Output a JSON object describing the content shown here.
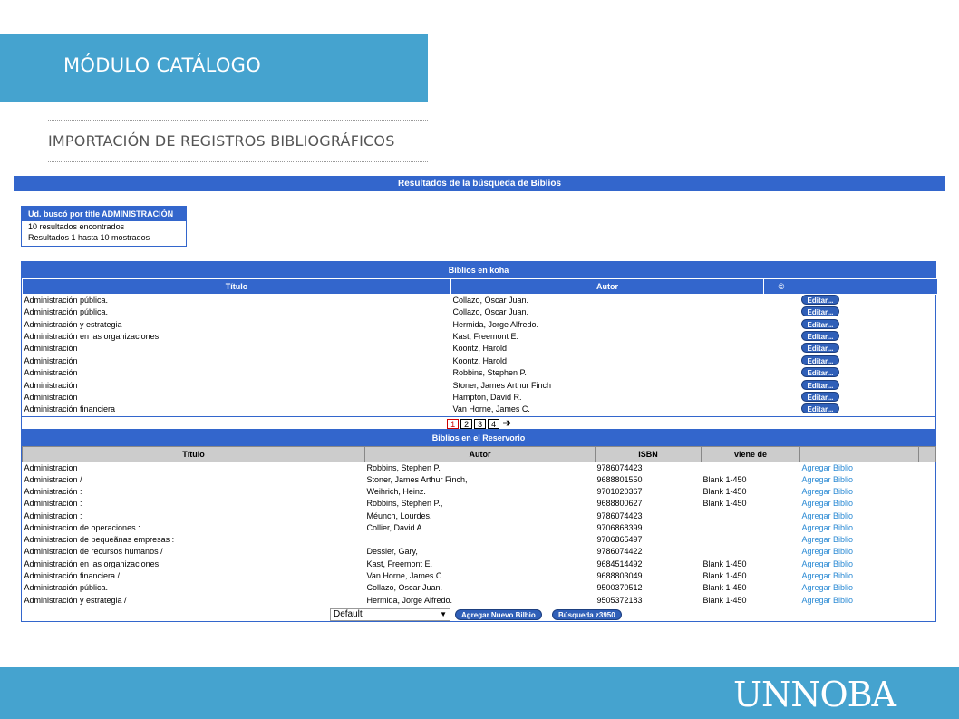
{
  "header": {
    "title": "MÓDULO CATÁLOGO",
    "subtitle": "IMPORTACIÓN DE REGISTROS BIBLIOGRÁFICOS"
  },
  "results_bar": "Resultados de la búsqueda de Biblios",
  "search_box": {
    "heading": "Ud. buscó por title ADMINISTRACIÓN",
    "line1": "10 resultados encontrados",
    "line2": "Resultados 1 hasta 10 mostrados"
  },
  "koha": {
    "title": "Biblios en koha",
    "columns": {
      "title": "Título",
      "author": "Autor",
      "copyright": "©"
    },
    "edit_label": "Editar...",
    "rows": [
      {
        "title": "Administración pública.",
        "author": "Collazo, Oscar Juan."
      },
      {
        "title": "Administración pública.",
        "author": "Collazo, Oscar Juan."
      },
      {
        "title": "Administración y estrategia",
        "author": "Hermida, Jorge Alfredo."
      },
      {
        "title": "Administración en las organizaciones",
        "author": "Kast, Freemont E."
      },
      {
        "title": "Administración",
        "author": "Koontz, Harold"
      },
      {
        "title": "Administración",
        "author": "Koontz, Harold"
      },
      {
        "title": "Administración",
        "author": "Robbins, Stephen P."
      },
      {
        "title": "Administración",
        "author": "Stoner, James Arthur Finch"
      },
      {
        "title": "Administración",
        "author": "Hampton, David R."
      },
      {
        "title": "Administración financiera",
        "author": "Van Horne, James C."
      }
    ],
    "pages": [
      "1",
      "2",
      "3",
      "4"
    ],
    "next_arrow": "➔"
  },
  "reservorio": {
    "title": "Biblios en el Reservorio",
    "columns": {
      "title": "Título",
      "author": "Autor",
      "isbn": "ISBN",
      "viene_de": "viene de"
    },
    "action_label": "Agregar Biblio",
    "rows": [
      {
        "title": "Administracion",
        "author": "Robbins, Stephen P.",
        "isbn": "9786074423",
        "source": ""
      },
      {
        "title": "Administracion /",
        "author": "Stoner, James Arthur Finch,",
        "isbn": "9688801550",
        "source": "Blank 1-450"
      },
      {
        "title": "Administración :",
        "author": "Weihrich, Heinz.",
        "isbn": "9701020367",
        "source": "Blank 1-450"
      },
      {
        "title": "Administración :",
        "author": "Robbins, Stephen P.,",
        "isbn": "9688800627",
        "source": "Blank 1-450"
      },
      {
        "title": "Administracion :",
        "author": "Méunch, Lourdes.",
        "isbn": "9786074423",
        "source": ""
      },
      {
        "title": "Administracion de operaciones :",
        "author": "Collier, David A.",
        "isbn": "9706868399",
        "source": ""
      },
      {
        "title": "Administracion de pequeãnas empresas :",
        "author": "",
        "isbn": "9706865497",
        "source": ""
      },
      {
        "title": "Administracion de recursos humanos /",
        "author": "Dessler, Gary,",
        "isbn": "9786074422",
        "source": ""
      },
      {
        "title": "Administración en las organizaciones",
        "author": "Kast, Freemont E.",
        "isbn": "9684514492",
        "source": "Blank 1-450"
      },
      {
        "title": "Administración financiera /",
        "author": "Van Horne, James C.",
        "isbn": "9688803049",
        "source": "Blank 1-450"
      },
      {
        "title": "Administración pública.",
        "author": "Collazo, Oscar Juan.",
        "isbn": "9500370512",
        "source": "Blank 1-450"
      },
      {
        "title": "Administración y estrategia /",
        "author": "Hermida, Jorge Alfredo.",
        "isbn": "9505372183",
        "source": "Blank 1-450"
      }
    ]
  },
  "bottom": {
    "select_value": "Default",
    "new_biblio_label": "Agregar Nuevo Bilbio",
    "search_label": "Búsqueda z3950"
  },
  "footer": {
    "logo": "UNNOBA"
  },
  "colors": {
    "header_blue": "#45a3cf",
    "table_blue": "#3366cc",
    "link_blue": "#2a8ad4"
  }
}
